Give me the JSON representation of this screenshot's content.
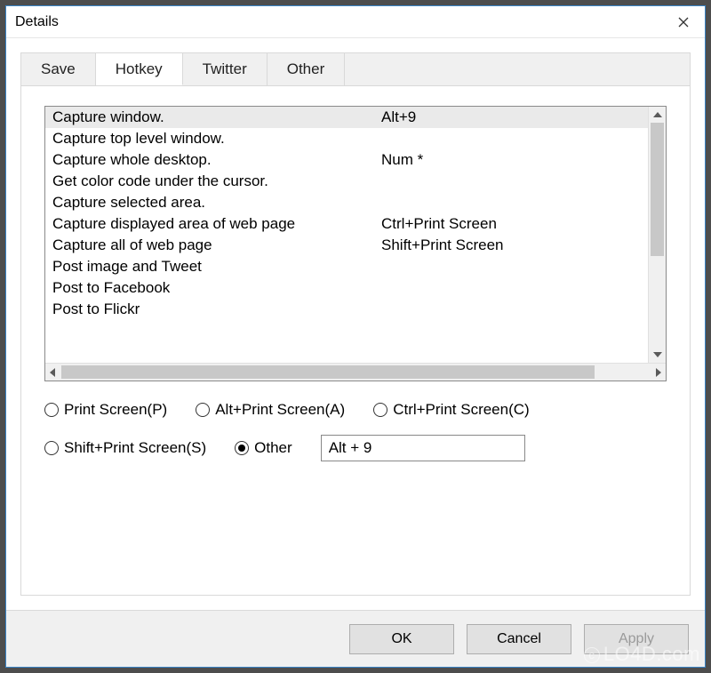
{
  "window": {
    "title": "Details"
  },
  "tabs": [
    {
      "label": "Save"
    },
    {
      "label": "Hotkey"
    },
    {
      "label": "Twitter"
    },
    {
      "label": "Other"
    }
  ],
  "active_tab_index": 1,
  "hotkey_list": [
    {
      "desc": "Capture window.",
      "key": "Alt+9",
      "selected": true
    },
    {
      "desc": "Capture top level window.",
      "key": ""
    },
    {
      "desc": "Capture whole desktop.",
      "key": "Num *"
    },
    {
      "desc": "Get color code under the cursor.",
      "key": ""
    },
    {
      "desc": "Capture selected area.",
      "key": ""
    },
    {
      "desc": "Capture displayed area of web page",
      "key": "Ctrl+Print Screen"
    },
    {
      "desc": "Capture all of web page",
      "key": "Shift+Print Screen"
    },
    {
      "desc": "Post image and Tweet",
      "key": ""
    },
    {
      "desc": "Post to Facebook",
      "key": ""
    },
    {
      "desc": "Post to Flickr",
      "key": ""
    }
  ],
  "radios": {
    "print_screen": "Print Screen(P)",
    "alt_print_screen": "Alt+Print Screen(A)",
    "ctrl_print_screen": "Ctrl+Print Screen(C)",
    "shift_print_screen": "Shift+Print Screen(S)",
    "other": "Other",
    "selected": "other"
  },
  "hotkey_input_value": "Alt + 9",
  "buttons": {
    "ok": "OK",
    "cancel": "Cancel",
    "apply": "Apply"
  },
  "watermark": "LO4D.com"
}
